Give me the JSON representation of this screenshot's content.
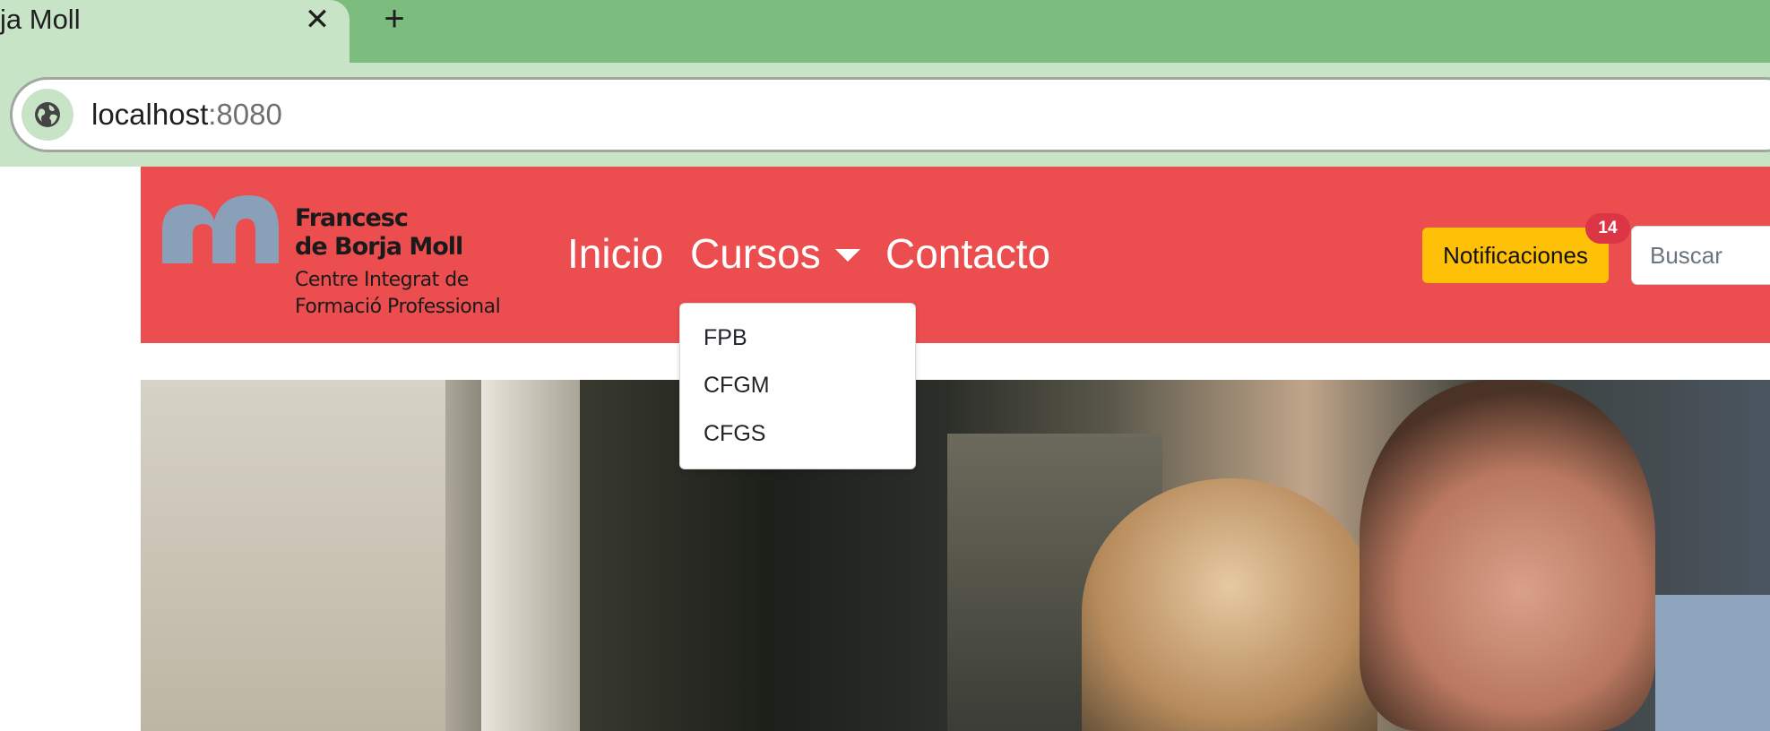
{
  "browser": {
    "tab_title": "ja Moll",
    "close_glyph": "✕",
    "new_tab_glyph": "+",
    "url_host": "localhost",
    "url_port": ":8080",
    "site_info_icon": "globe-icon"
  },
  "navbar": {
    "logo": {
      "line1": "Francesc",
      "line2": "de Borja Moll",
      "line3": "Centre Integrat de",
      "line4": "Formació Professional",
      "mark_color": "#8aa0b8"
    },
    "links": {
      "inicio": "Inicio",
      "cursos": "Cursos",
      "contacto": "Contacto"
    },
    "notifications_label": "Notificaciones",
    "notifications_count": "14",
    "search_placeholder": "Buscar",
    "colors": {
      "navbar_bg": "#ec4d4e",
      "notif_bg": "#ffc107",
      "badge_bg": "#dc3545"
    }
  },
  "dropdown": {
    "items": [
      "FPB",
      "CFGM",
      "CFGS"
    ]
  }
}
